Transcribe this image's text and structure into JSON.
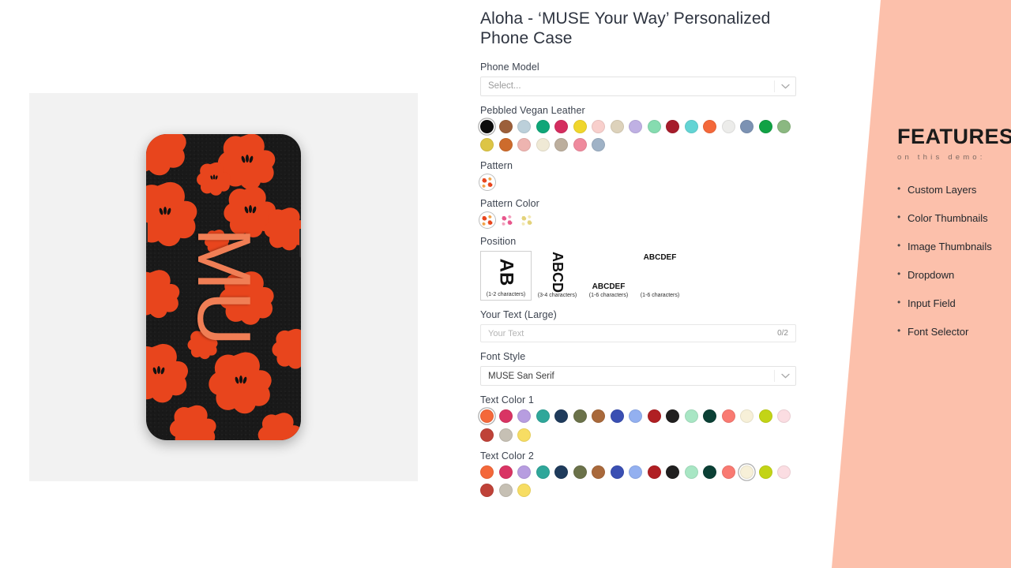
{
  "product": {
    "title": "Aloha - ‘MUSE Your Way’ Personalized Phone Case",
    "preview": {
      "monogram_text": "MU",
      "case_base_color": "#191919",
      "pattern_color": "#e8451d",
      "monogram_color": "#f07e55",
      "background": "#f2f2f2"
    }
  },
  "fields": {
    "phone_model": {
      "label": "Phone Model",
      "placeholder": "Select...",
      "value": "",
      "chevron_icon": "chevron-down-icon"
    },
    "leather": {
      "label": "Pebbled Vegan Leather",
      "selected_index": 0,
      "swatches": [
        "#0c0c0c",
        "#9c5f3a",
        "#bcd0da",
        "#0fa678",
        "#d42d5f",
        "#f0d62c",
        "#f8cfcc",
        "#ddd2bb",
        "#bfb0e3",
        "#86dcb0",
        "#a61c2b",
        "#63d4d4",
        "#f4683a",
        "#ececea",
        "#7c92b3",
        "#11a245",
        "#8bb881",
        "#ddc545",
        "#cd6b2c",
        "#eeb4b0",
        "#efe9d5",
        "#bcae9d",
        "#ef8a9d",
        "#9fb2c6"
      ]
    },
    "pattern": {
      "label": "Pattern",
      "selected_index": 0,
      "thumbs": [
        {
          "name": "aloha-flower-pattern",
          "petal": "#e8451d",
          "accent": "#f2a34a"
        }
      ]
    },
    "pattern_color": {
      "label": "Pattern Color",
      "selected_index": 0,
      "thumbs": [
        {
          "name": "pattern-color-orange",
          "petal": "#e8451d",
          "accent": "#f2a34a"
        },
        {
          "name": "pattern-color-pink",
          "petal": "#e8568c",
          "accent": "#f2a0bd"
        },
        {
          "name": "pattern-color-cream",
          "petal": "#e3d27a",
          "accent": "#f3e9b4"
        }
      ]
    },
    "position": {
      "label": "Position",
      "selected_index": 0,
      "options": [
        {
          "sample": "AB",
          "caption": "(1-2 characters)"
        },
        {
          "sample": "ABCD",
          "caption": "(3-4 characters)"
        },
        {
          "sample": "ABCDEF",
          "caption": "(1-6 characters)"
        },
        {
          "sample": "ABCDEF",
          "caption": "(1-6 characters)"
        }
      ]
    },
    "your_text": {
      "label": "Your Text (Large)",
      "placeholder": "Your Text",
      "value": "",
      "counter": "0/2"
    },
    "font_style": {
      "label": "Font Style",
      "value": "MUSE San Serif",
      "chevron_icon": "chevron-down-icon"
    },
    "text_color_1": {
      "label": "Text Color 1",
      "selected_index": 0,
      "swatches": [
        "#f4683a",
        "#d93464",
        "#b79de0",
        "#2fa79a",
        "#1f3b5c",
        "#6b724a",
        "#a9693b",
        "#3a4fb3",
        "#93b0f0",
        "#b01f23",
        "#201f1f",
        "#a8e6c4",
        "#0b4035",
        "#f97a72",
        "#f7f0d8",
        "#c3d416",
        "#fbdde2",
        "#bf4238",
        "#c6c0b4",
        "#f7dd63"
      ]
    },
    "text_color_2": {
      "label": "Text Color 2",
      "selected_index": 14,
      "swatches": [
        "#f4683a",
        "#d93464",
        "#b79de0",
        "#2fa79a",
        "#1f3b5c",
        "#6b724a",
        "#a9693b",
        "#3a4fb3",
        "#93b0f0",
        "#b01f23",
        "#201f1f",
        "#a8e6c4",
        "#0b4035",
        "#f97a72",
        "#f7f0d8",
        "#c3d416",
        "#fbdde2",
        "#bf4238",
        "#c6c0b4",
        "#f7dd63"
      ]
    }
  },
  "features": {
    "title": "FEATURES",
    "subtitle": "on this demo:",
    "panel_color": "#fcc0ab",
    "items": [
      "Custom Layers",
      "Color Thumbnails",
      "Image Thumbnails",
      "Dropdown",
      "Input Field",
      "Font Selector"
    ]
  }
}
